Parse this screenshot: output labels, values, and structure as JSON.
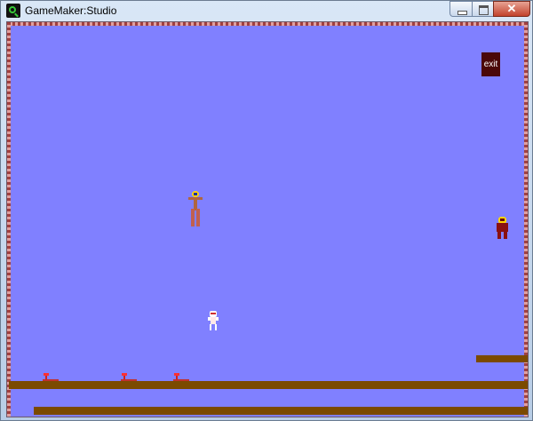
{
  "window": {
    "title": "GameMaker:Studio",
    "close_glyph": "✕"
  },
  "icons": {
    "app": "gamemaker-logo-icon",
    "minimize": "minimize-icon",
    "maximize": "maximize-icon",
    "close": "close-icon"
  },
  "game": {
    "exit_label": "exit",
    "colors": {
      "background": "#8080ff",
      "platform": "#7b4a00",
      "exit_button": "#4a0808"
    },
    "sprites": [
      "player-sprite",
      "brown-enemy-sprite",
      "red-enemy-sprite",
      "spring-pad",
      "spring-pad",
      "spring-pad"
    ]
  }
}
